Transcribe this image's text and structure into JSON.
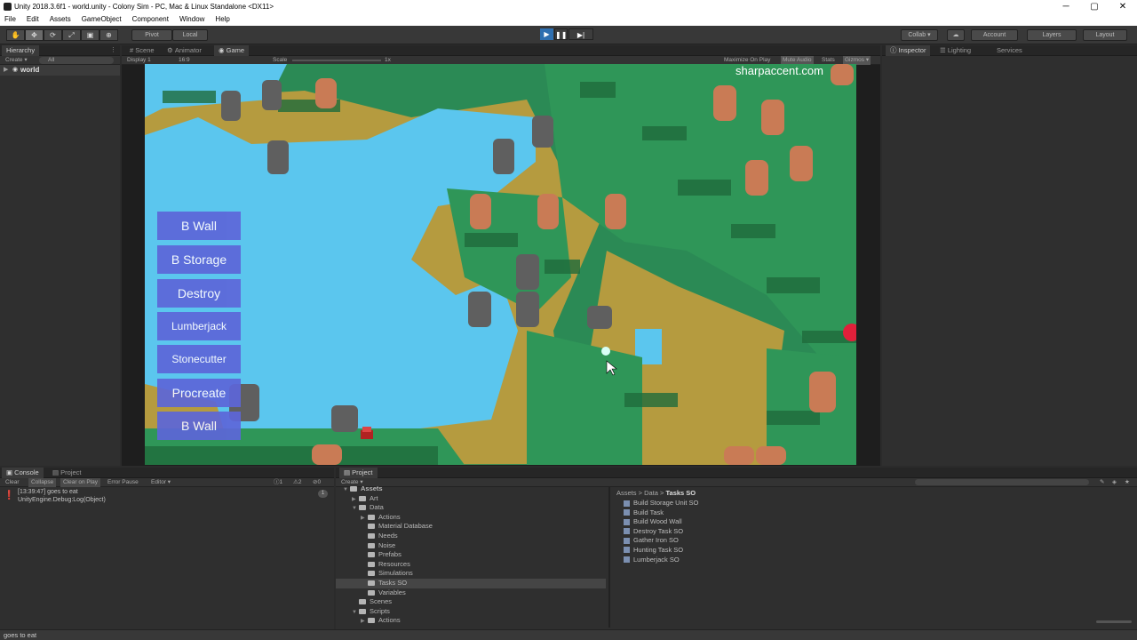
{
  "window": {
    "title": "Unity 2018.3.6f1 - world.unity - Colony Sim - PC, Mac & Linux Standalone <DX11>",
    "min": "─",
    "max": "▢",
    "close": "✕"
  },
  "menu": [
    "File",
    "Edit",
    "Assets",
    "GameObject",
    "Component",
    "Window",
    "Help"
  ],
  "toolbar": {
    "tools": [
      "✋",
      "✥",
      "⟳",
      "⤢",
      "▣",
      "⊕"
    ],
    "pivot": "Pivot",
    "local": "Local",
    "play": "▶",
    "pause": "❚❚",
    "step": "▶|",
    "collab": "Collab ▾",
    "cloud": "☁",
    "account": "Account",
    "layers": "Layers",
    "layout": "Layout"
  },
  "hierarchy": {
    "tab": "Hierarchy",
    "create": "Create ▾",
    "search": "All",
    "root": "world"
  },
  "scene_tabs": {
    "scene": "Scene",
    "animator": "Animator",
    "game": "Game"
  },
  "game_bar": {
    "display": "Display 1",
    "aspect": "16:9",
    "scale_label": "Scale",
    "scale_value": "1x",
    "maximize": "Maximize On Play",
    "mute": "Mute Audio",
    "stats": "Stats",
    "gizmos": "Gizmos ▾"
  },
  "watermark": "sharpaccent.com",
  "game_buttons": [
    "B Wall",
    "B Storage",
    "Destroy",
    "Lumberjack",
    "Stonecutter",
    "Procreate",
    "B Wall"
  ],
  "inspector_tabs": {
    "inspector": "Inspector",
    "lighting": "Lighting",
    "services": "Services"
  },
  "console": {
    "tab": "Console",
    "project_tab": "Project",
    "buttons": [
      "Clear",
      "Collapse",
      "Clear on Play",
      "Error Pause",
      "Editor ▾"
    ],
    "counts": {
      "info": "1",
      "warn": "2",
      "error": "0"
    },
    "log_line1": "[13:39:47] goes to eat",
    "log_line2": "UnityEngine.Debug:Log(Object)",
    "log_count": "1"
  },
  "project": {
    "tab": "Project",
    "create": "Create ▾",
    "tree": [
      {
        "label": "Assets",
        "level": 0,
        "arrow": "▼"
      },
      {
        "label": "Art",
        "level": 1,
        "arrow": "▶"
      },
      {
        "label": "Data",
        "level": 1,
        "arrow": "▼"
      },
      {
        "label": "Actions",
        "level": 2,
        "arrow": "▶"
      },
      {
        "label": "Material Database",
        "level": 2,
        "arrow": ""
      },
      {
        "label": "Needs",
        "level": 2,
        "arrow": ""
      },
      {
        "label": "Noise",
        "level": 2,
        "arrow": ""
      },
      {
        "label": "Prefabs",
        "level": 2,
        "arrow": ""
      },
      {
        "label": "Resources",
        "level": 2,
        "arrow": ""
      },
      {
        "label": "Simulations",
        "level": 2,
        "arrow": ""
      },
      {
        "label": "Tasks SO",
        "level": 2,
        "arrow": ""
      },
      {
        "label": "Variables",
        "level": 2,
        "arrow": ""
      },
      {
        "label": "Scenes",
        "level": 1,
        "arrow": ""
      },
      {
        "label": "Scripts",
        "level": 1,
        "arrow": "▼"
      },
      {
        "label": "Actions",
        "level": 2,
        "arrow": "▶"
      }
    ],
    "breadcrumb": [
      "Assets",
      ">",
      "Data",
      ">",
      "Tasks SO"
    ],
    "assets": [
      "Build Storage Unit SO",
      "Build Task",
      "Build Wood Wall",
      "Destroy Task SO",
      "Gather Iron SO",
      "Hunting Task SO",
      "Lumberjack SO"
    ]
  },
  "status_bar": "goes to eat"
}
